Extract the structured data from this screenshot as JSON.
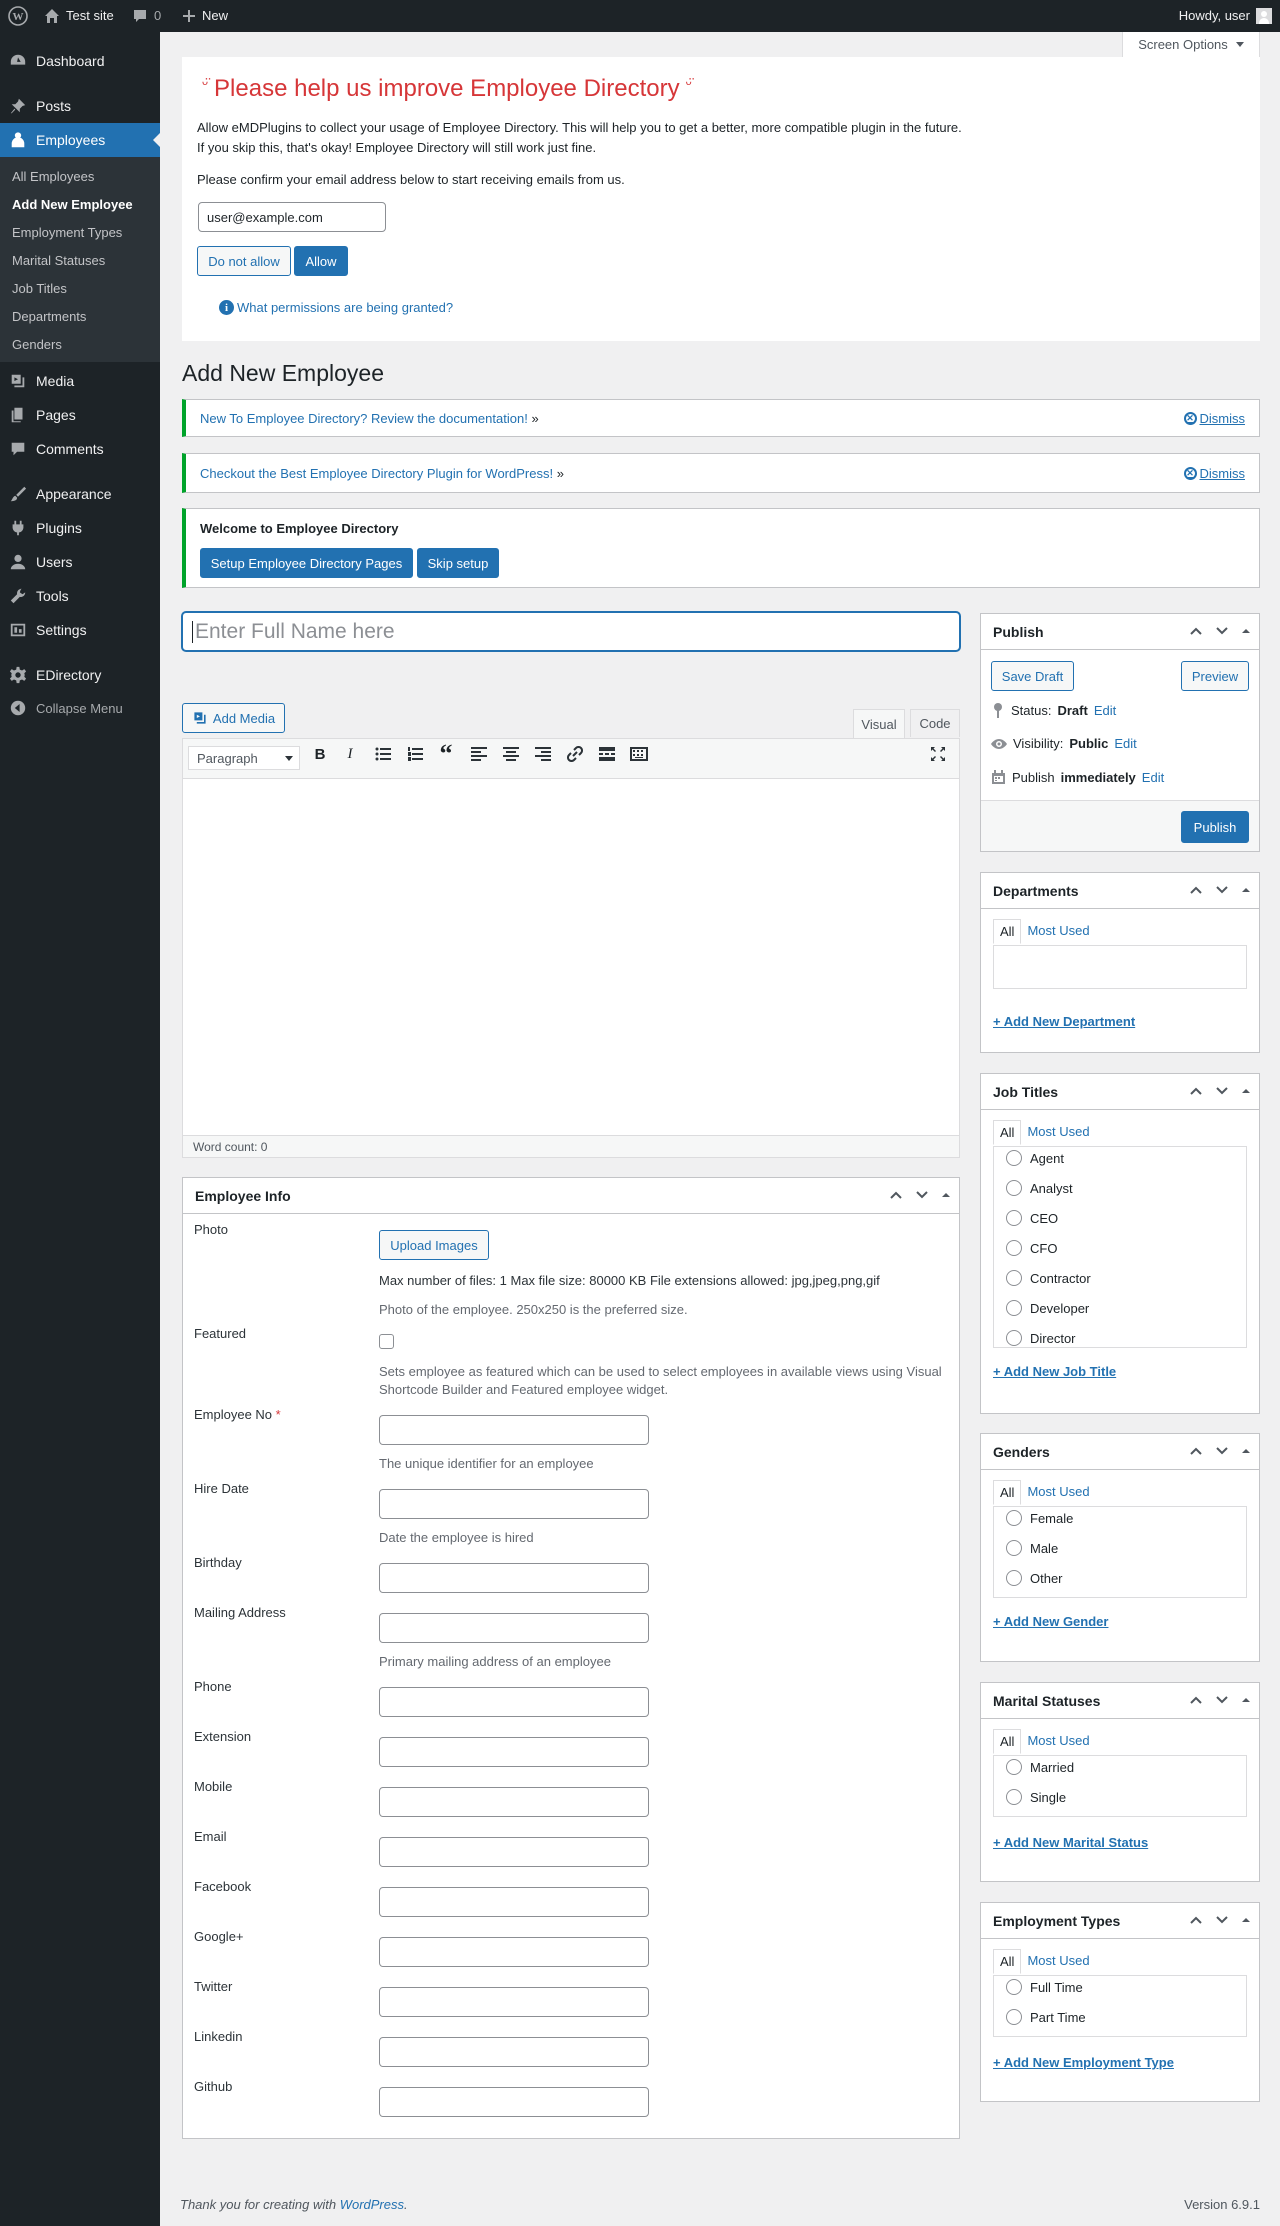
{
  "adminbar": {
    "site_name": "Test site",
    "comments_count": "0",
    "new_label": "New",
    "howdy": "Howdy, user"
  },
  "sidebar": {
    "items": [
      {
        "label": "Dashboard",
        "icon": "dashboard-icon"
      },
      {
        "label": "Posts",
        "icon": "pin-icon"
      },
      {
        "label": "Employees",
        "icon": "employees-icon"
      },
      {
        "label": "Media",
        "icon": "media-icon"
      },
      {
        "label": "Pages",
        "icon": "page-icon"
      },
      {
        "label": "Comments",
        "icon": "comment-icon"
      },
      {
        "label": "Appearance",
        "icon": "brush-icon"
      },
      {
        "label": "Plugins",
        "icon": "plugin-icon"
      },
      {
        "label": "Users",
        "icon": "users-icon"
      },
      {
        "label": "Tools",
        "icon": "wrench-icon"
      },
      {
        "label": "Settings",
        "icon": "settings-icon"
      },
      {
        "label": "EDirectory",
        "icon": "gear-icon"
      },
      {
        "label": "Collapse Menu",
        "icon": "collapse-icon"
      }
    ],
    "submenu": [
      "All Employees",
      "Add New Employee",
      "Employment Types",
      "Marital Statuses",
      "Job Titles",
      "Departments",
      "Genders"
    ]
  },
  "screen_options": "Screen Options",
  "optin": {
    "title": "Please help us improve Employee Directory",
    "line1": "Allow eMDPlugins to collect your usage of Employee Directory. This will help you to get a better, more compatible plugin in the future.",
    "line2": "If you skip this, that's okay! Employee Directory will still work just fine.",
    "line3": "Please confirm your email address below to start receiving emails from us.",
    "email": "user@example.com",
    "deny": "Do not allow",
    "allow": "Allow",
    "permissions_link": "What permissions are being granted?"
  },
  "page_title": "Add New Employee",
  "notices": {
    "n1": "New To Employee Directory? Review the documentation!",
    "n2": "Checkout the Best Employee Directory Plugin for WordPress!",
    "arrow": "»",
    "dismiss": "Dismiss",
    "welcome_title": "Welcome to Employee Directory",
    "setup_btn": "Setup Employee Directory Pages",
    "skip_btn": "Skip setup"
  },
  "editor": {
    "title_placeholder": "Enter Full Name here",
    "add_media": "Add Media",
    "tab_visual": "Visual",
    "tab_code": "Code",
    "format": "Paragraph",
    "word_count": "Word count: 0"
  },
  "employee_info": {
    "title": "Employee Info",
    "photo_label": "Photo",
    "upload_btn": "Upload Images",
    "photo_note1": "Max number of files: 1 Max file size: 80000 KB File extensions allowed: jpg,jpeg,png,gif",
    "photo_note2": "Photo of the employee. 250x250 is the preferred size.",
    "featured_label": "Featured",
    "featured_desc1": "Sets employee as featured which can be used to select employees in available views using Visual",
    "featured_desc2": "Shortcode Builder and Featured employee widget.",
    "empno_label": "Employee No",
    "required_mark": "*",
    "empno_desc": "The unique identifier for an employee",
    "hire_label": "Hire Date",
    "hire_desc": "Date the employee is hired",
    "birthday_label": "Birthday",
    "mailing_label": "Mailing Address",
    "mailing_desc": "Primary mailing address of an employee",
    "phone_label": "Phone",
    "extension_label": "Extension",
    "mobile_label": "Mobile",
    "email_label": "Email",
    "facebook_label": "Facebook",
    "googleplus_label": "Google+",
    "twitter_label": "Twitter",
    "linkedin_label": "Linkedin",
    "github_label": "Github"
  },
  "publish": {
    "title": "Publish",
    "save_draft": "Save Draft",
    "preview": "Preview",
    "status_label": "Status:",
    "status_value": "Draft",
    "visibility_label": "Visibility:",
    "visibility_value": "Public",
    "publish_label": "Publish",
    "publish_value": "immediately",
    "edit": "Edit",
    "publish_btn": "Publish"
  },
  "tax": {
    "all": "All",
    "most_used": "Most Used",
    "departments": {
      "title": "Departments",
      "add": "+ Add New Department"
    },
    "job_titles": {
      "title": "Job Titles",
      "items": [
        "Agent",
        "Analyst",
        "CEO",
        "CFO",
        "Contractor",
        "Developer",
        "Director"
      ],
      "add": "+ Add New Job Title"
    },
    "genders": {
      "title": "Genders",
      "items": [
        "Female",
        "Male",
        "Other"
      ],
      "add": "+ Add New Gender"
    },
    "marital": {
      "title": "Marital Statuses",
      "items": [
        "Married",
        "Single"
      ],
      "add": "+ Add New Marital Status"
    },
    "employment": {
      "title": "Employment Types",
      "items": [
        "Full Time",
        "Part Time"
      ],
      "add": "+ Add New Employment Type"
    }
  },
  "footer": {
    "thanks": "Thank you for creating with",
    "wp_link": "WordPress",
    "period": ".",
    "version": "Version 6.9.1"
  },
  "colors": {
    "accent": "#2271b1",
    "optin_title": "#d63638",
    "notice_border": "#00a32a",
    "sidebar": "#1d2327"
  }
}
